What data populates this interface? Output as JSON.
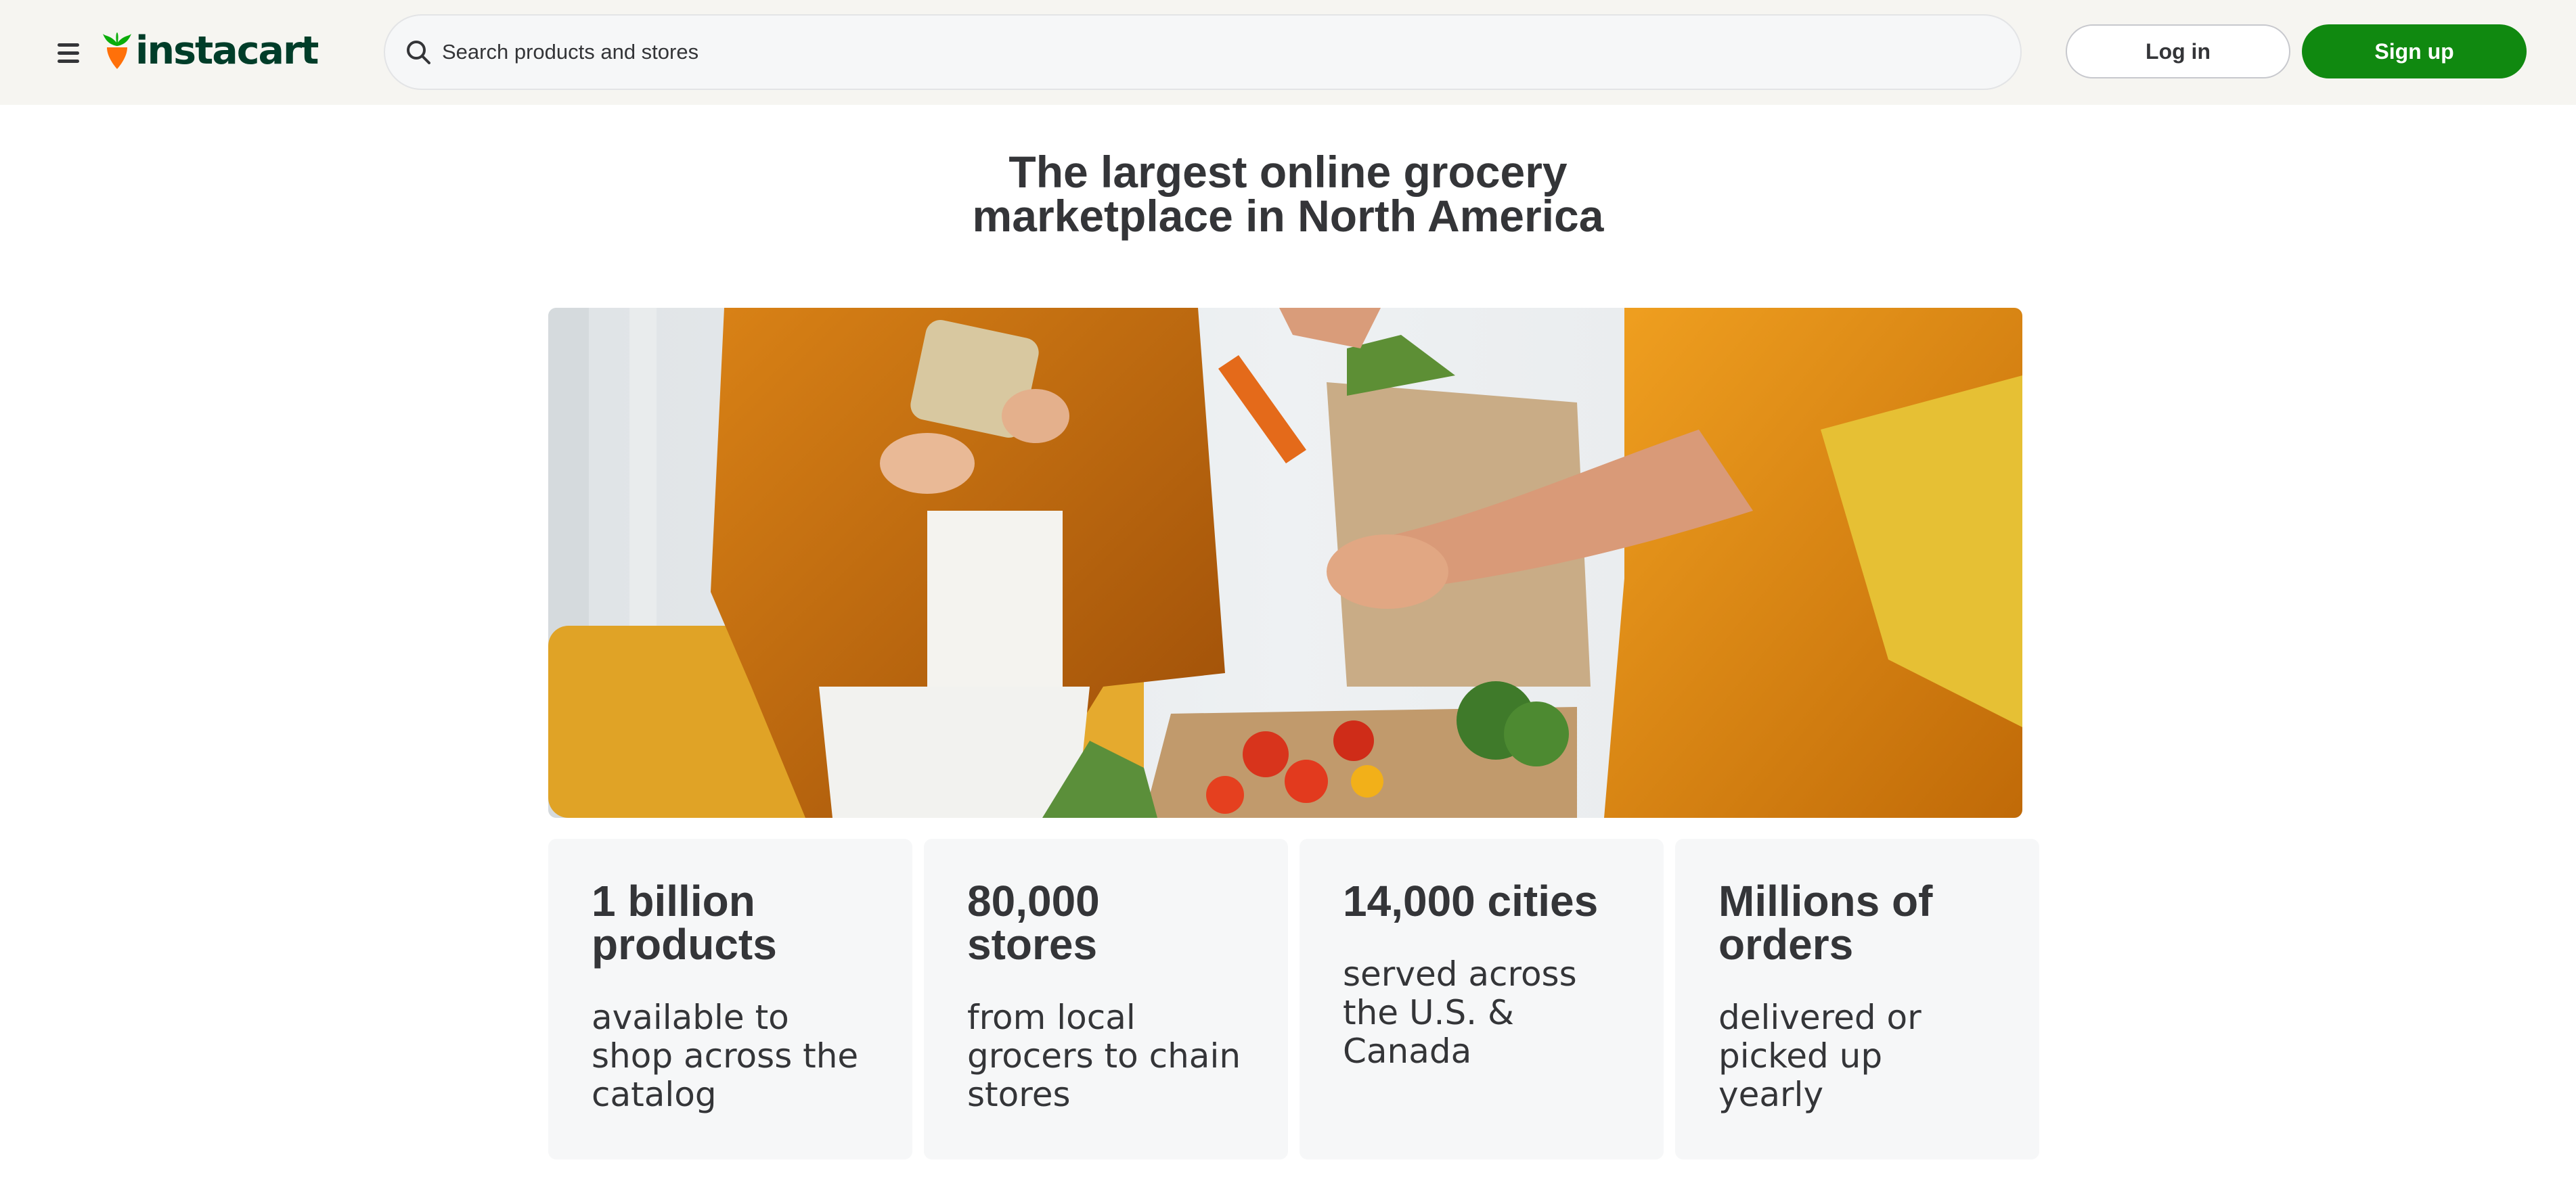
{
  "header": {
    "logo_text": "instacart",
    "search": {
      "placeholder": "Search products and stores",
      "value": ""
    },
    "login_label": "Log in",
    "signup_label": "Sign up"
  },
  "hero": {
    "title_line1": "The largest online grocery",
    "title_line2": "marketplace in North America"
  },
  "stats": [
    {
      "title": "1 billion products",
      "description": "available to shop across the catalog"
    },
    {
      "title": "80,000 stores",
      "description": "from local grocers to chain stores"
    },
    {
      "title": "14,000 cities",
      "description": "served across the U.S. & Canada"
    },
    {
      "title": "Millions of orders",
      "description": "delivered or picked up yearly"
    }
  ],
  "colors": {
    "brand_green": "#108910",
    "logo_green": "#003d29",
    "carrot_orange": "#ff7009",
    "header_bg": "#f6f5f1",
    "card_bg": "#f6f7f8",
    "text": "#343538"
  },
  "icons": {
    "menu": "hamburger-menu-icon",
    "search": "magnifier-icon",
    "logo": "carrot-icon"
  }
}
